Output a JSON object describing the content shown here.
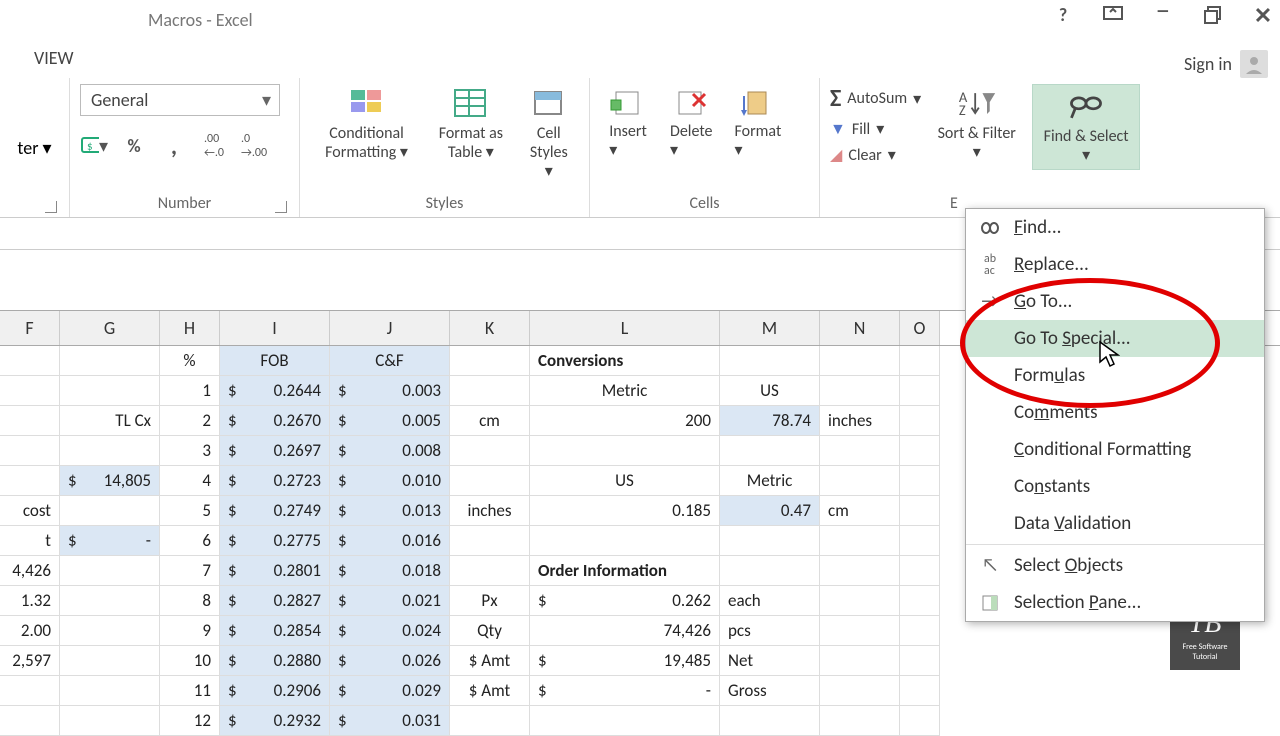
{
  "title": "Macros - Excel",
  "tab": "VIEW",
  "signin": "Sign in",
  "ribbon": {
    "alignment_partial": "ter",
    "number_format": "General",
    "number_label": "Number",
    "styles_label": "Styles",
    "cells_label": "Cells",
    "cond_fmt": "Conditional Formatting",
    "fmt_table": "Format as Table",
    "cell_styles": "Cell Styles",
    "insert": "Insert",
    "delete": "Delete",
    "format": "Format",
    "autosum": "AutoSum",
    "fill": "Fill",
    "clear": "Clear",
    "sort_filter": "Sort & Filter",
    "find_select": "Find & Select"
  },
  "dropdown": {
    "find": "Find...",
    "replace": "Replace...",
    "goto": "Go To...",
    "goto_special": "Go To Special...",
    "formulas": "Formulas",
    "comments": "Comments",
    "cond_fmt": "Conditional Formatting",
    "constants": "Constants",
    "data_val": "Data Validation",
    "sel_obj": "Select Objects",
    "sel_pane": "Selection Pane..."
  },
  "cols": [
    "F",
    "G",
    "H",
    "I",
    "J",
    "K",
    "L",
    "M",
    "N",
    "O"
  ],
  "widths": [
    60,
    100,
    60,
    110,
    120,
    80,
    190,
    100,
    80,
    40
  ],
  "row1": {
    "H": "%",
    "I": "FOB",
    "J": "C&F",
    "L": "Conversions"
  },
  "data_rows": [
    {
      "F": "",
      "G": "",
      "H": "1",
      "I": "0.2644",
      "J": "0.003",
      "K": "",
      "L": "Metric",
      "M": "US",
      "N": ""
    },
    {
      "F": "",
      "G": "TL Cx",
      "H": "2",
      "I": "0.2670",
      "J": "0.005",
      "K": "cm",
      "L": "200",
      "M": "78.74",
      "N": "inches"
    },
    {
      "F": "",
      "G": "",
      "H": "3",
      "I": "0.2697",
      "J": "0.008",
      "K": "",
      "L": "",
      "M": "",
      "N": ""
    },
    {
      "F": "",
      "G": "$ 14,805",
      "H": "4",
      "I": "0.2723",
      "J": "0.010",
      "K": "",
      "L": "US",
      "M": "Metric",
      "N": ""
    },
    {
      "F": "cost",
      "G": "",
      "H": "5",
      "I": "0.2749",
      "J": "0.013",
      "K": "inches",
      "L": "0.185",
      "M": "0.47",
      "N": "cm"
    },
    {
      "F": "t",
      "G": "$      -",
      "H": "6",
      "I": "0.2775",
      "J": "0.016",
      "K": "",
      "L": "",
      "M": "",
      "N": ""
    },
    {
      "F": "4,426",
      "G": "",
      "H": "7",
      "I": "0.2801",
      "J": "0.018",
      "K": "",
      "L": "Order Information",
      "M": "",
      "N": ""
    },
    {
      "F": "1.32",
      "G": "",
      "H": "8",
      "I": "0.2827",
      "J": "0.021",
      "K": "Px",
      "L": "$            0.262",
      "M": "each",
      "N": ""
    },
    {
      "F": "2.00",
      "G": "",
      "H": "9",
      "I": "0.2854",
      "J": "0.024",
      "K": "Qty",
      "L": "74,426",
      "M": "pcs",
      "N": ""
    },
    {
      "F": "2,597",
      "G": "",
      "H": "10",
      "I": "0.2880",
      "J": "0.026",
      "K": "$ Amt",
      "L": "$          19,485",
      "M": "Net",
      "N": ""
    },
    {
      "F": "",
      "G": "",
      "H": "11",
      "I": "0.2906",
      "J": "0.029",
      "K": "$ Amt",
      "L": "$                  -",
      "M": "Gross",
      "N": ""
    },
    {
      "F": "",
      "G": "",
      "H": "12",
      "I": "0.2932",
      "J": "0.031",
      "K": "",
      "L": "",
      "M": "",
      "N": ""
    }
  ],
  "logo": {
    "big": "TB",
    "small": "Free Software Tutorial"
  }
}
